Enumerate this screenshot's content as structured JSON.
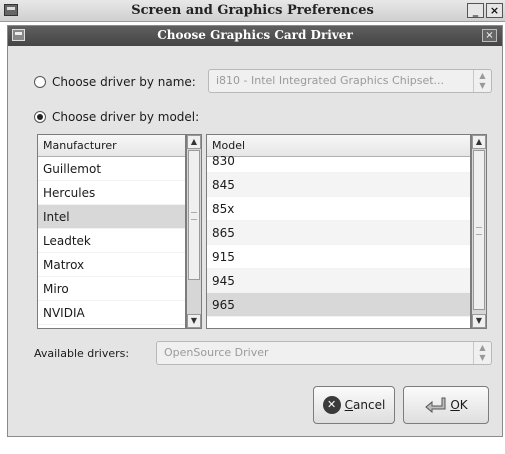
{
  "outer_window": {
    "title": "Screen and Graphics Preferences",
    "minimize_label": "_",
    "close_label": "×"
  },
  "dialog": {
    "title": "Choose Graphics Card Driver",
    "close_label": "×",
    "by_name": {
      "label": "Choose driver by name:",
      "selected": false,
      "value": "i810 - Intel Integrated Graphics Chipset..."
    },
    "by_model": {
      "label": "Choose driver by model:",
      "selected": true
    },
    "manufacturer_list": {
      "header": "Manufacturer",
      "items": [
        "Guillemot",
        "Hercules",
        "Intel",
        "Leadtek",
        "Matrox",
        "Miro",
        "NVIDIA"
      ],
      "selected": "Intel"
    },
    "model_list": {
      "header": "Model",
      "items": [
        "830",
        "845",
        "85x",
        "865",
        "915",
        "945",
        "965"
      ],
      "selected": "965"
    },
    "available_drivers": {
      "label": "Available drivers:",
      "value": "OpenSource Driver"
    },
    "buttons": {
      "cancel": {
        "prefix": "",
        "mnemonic": "C",
        "rest": "ancel"
      },
      "ok": {
        "mnemonic": "O",
        "rest": "K"
      }
    }
  },
  "icons": {
    "cancel": "cancel-icon",
    "ok": "ok-arrow-icon",
    "window_menu": "window-menu-icon"
  }
}
